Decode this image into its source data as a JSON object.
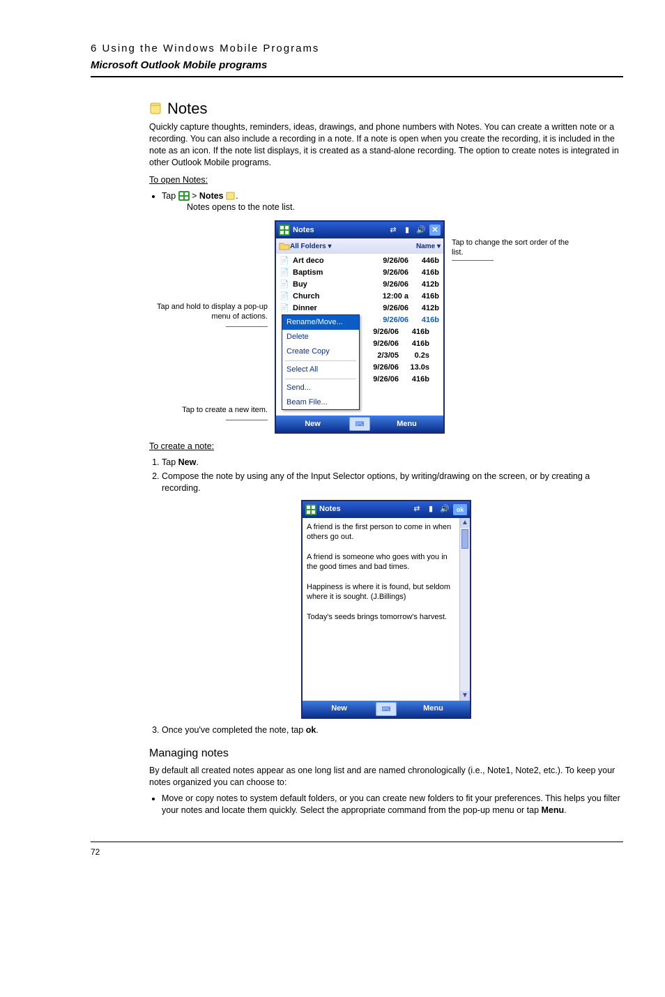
{
  "header": {
    "line1": "6 Using the Windows Mobile Programs",
    "line2": "Microsoft Outlook Mobile programs"
  },
  "page_number": "72",
  "section": {
    "title": "Notes",
    "intro": "Quickly capture thoughts, reminders, ideas, drawings, and phone numbers with Notes. You can create a written note or a recording. You can also include a recording in a note. If a note is open when you create the recording, it is included in the note as an icon. If the note list displays, it is created as a stand-alone recording. The option to create notes is integrated in other Outlook Mobile programs.",
    "open_heading": "To open Notes:",
    "open_step_prefix": "Tap ",
    "open_step_mid": " > ",
    "open_step_bold": "Notes",
    "open_step_suffix": " .",
    "open_step_line2": "Notes opens to the note list."
  },
  "callouts": {
    "left1": "Tap and hold to display a pop-up menu of actions.",
    "left2": "Tap to create a new item.",
    "right1": "Tap to change the sort order of the list."
  },
  "fig1": {
    "title": "Notes",
    "folder": "All Folders ▾",
    "sort": "Name ▾",
    "rows": [
      {
        "n": "Art deco",
        "d": "9/26/06",
        "s": "446b"
      },
      {
        "n": "Baptism",
        "d": "9/26/06",
        "s": "416b"
      },
      {
        "n": "Buy",
        "d": "9/26/06",
        "s": "412b"
      },
      {
        "n": "Church",
        "d": "12:00 a",
        "s": "416b"
      },
      {
        "n": "Dinner",
        "d": "9/26/06",
        "s": "412b"
      }
    ],
    "sel": {
      "n": "",
      "d": "9/26/06",
      "s": "416b"
    },
    "rest": [
      {
        "d": "9/26/06",
        "s": "416b"
      },
      {
        "d": "9/26/06",
        "s": "416b"
      },
      {
        "d": "2/3/05",
        "s": "0.2s"
      },
      {
        "d": "9/26/06",
        "s": "13.0s"
      },
      {
        "d": "9/26/06",
        "s": "416b"
      }
    ],
    "menu": [
      "Rename/Move...",
      "Delete",
      "Create Copy",
      "Select All",
      "Send...",
      "Beam File..."
    ],
    "new": "New",
    "menu_btn": "Menu"
  },
  "create": {
    "heading": "To create a note:",
    "s1_pre": "Tap ",
    "s1_bold": "New",
    "s1_post": ".",
    "s2": "Compose the note by using any of the Input Selector options, by writing/drawing on the screen, or by creating a recording.",
    "s3_pre": "Once you've completed the note, tap ",
    "s3_bold": "ok",
    "s3_post": "."
  },
  "fig2": {
    "title": "Notes",
    "ok": "ok",
    "p1": "A friend is the first person to come in when others go out.",
    "p2": "A friend is someone who goes with you in the good times and bad times.",
    "p3": "Happiness is where it is found, but seldom where it is sought. (J.Billings)",
    "p4": "Today's seeds brings tomorrow's harvest.",
    "new": "New",
    "menu": "Menu"
  },
  "manage": {
    "heading": "Managing notes",
    "p1": "By default all created notes appear as one long list and are named chronologically (i.e., Note1, Note2, etc.). To keep your notes organized you can choose to:",
    "b1_pre": "Move or copy notes to system default folders, or you can create new folders to fit your preferences. This helps you filter your notes and locate them quickly. Select the appropriate command from the pop-up menu or tap ",
    "b1_bold": "Menu",
    "b1_post": "."
  }
}
